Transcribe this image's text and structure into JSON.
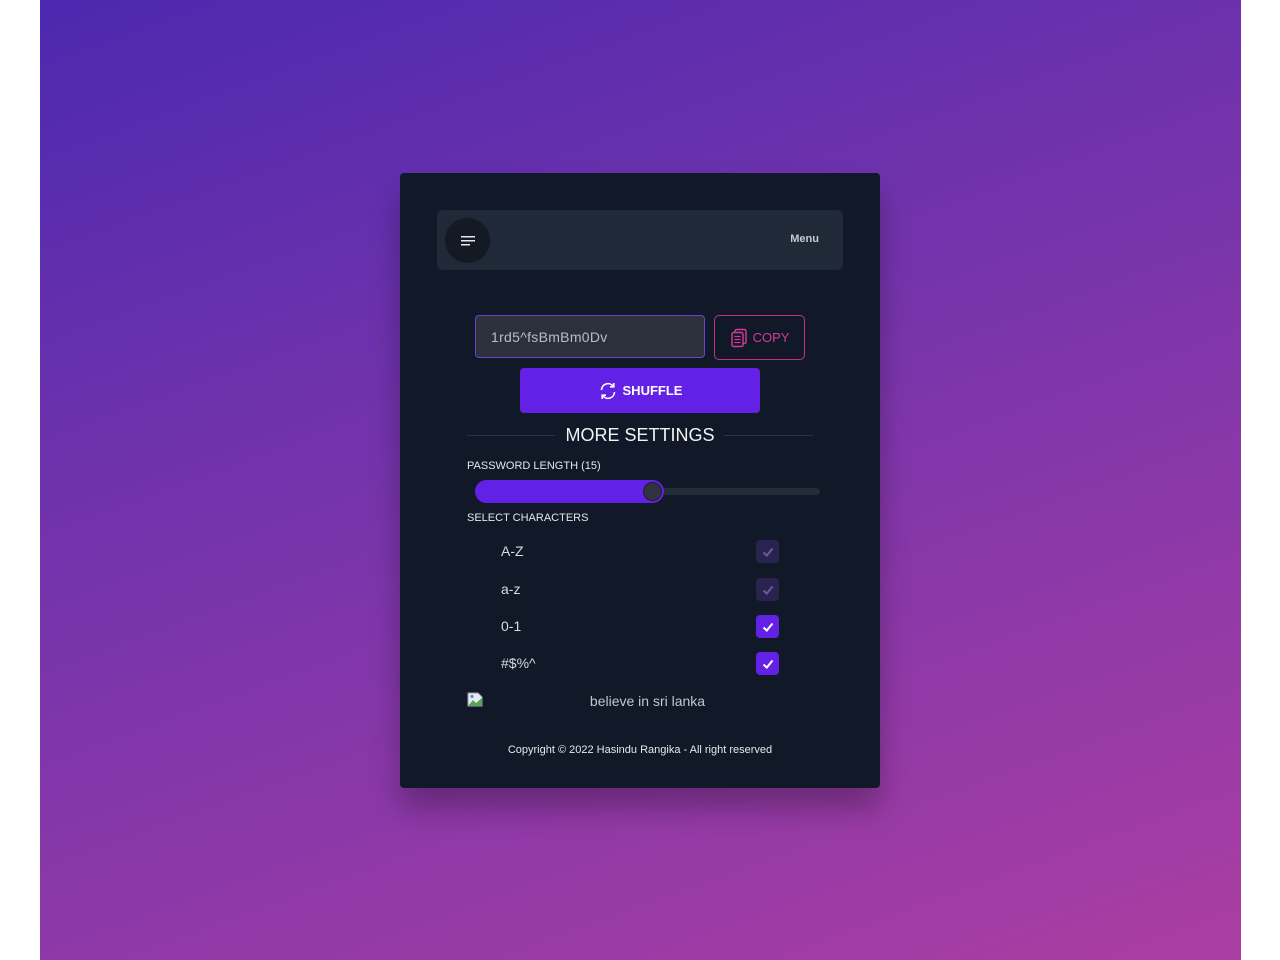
{
  "header": {
    "menu_label": "Menu"
  },
  "generator": {
    "password_value": "1rd5^fsBmBm0Dv",
    "copy_label": "COPY",
    "shuffle_label": "SHUFFLE"
  },
  "settings": {
    "title": "MORE SETTINGS",
    "length_label": "PASSWORD LENGTH (15)",
    "length_fraction": 0.52,
    "characters_label": "SELECT CHARACTERS",
    "options": [
      {
        "label": "A-Z",
        "checked": true,
        "disabled": true
      },
      {
        "label": "a-z",
        "checked": true,
        "disabled": true
      },
      {
        "label": "0-1",
        "checked": true,
        "disabled": false
      },
      {
        "label": "#$%^",
        "checked": true,
        "disabled": false
      }
    ]
  },
  "footer": {
    "slogan": "believe in sri lanka",
    "copyright": "Copyright © 2022 Hasindu Rangika - All right reserved"
  },
  "colors": {
    "accent": "#6321e6",
    "copy_accent": "#d33a9a",
    "card_bg": "#111827"
  },
  "icons": {
    "menu": "hamburger-icon",
    "copy": "clipboard-icon",
    "shuffle": "refresh-icon",
    "check": "check-icon",
    "flag": "broken-image-icon"
  }
}
